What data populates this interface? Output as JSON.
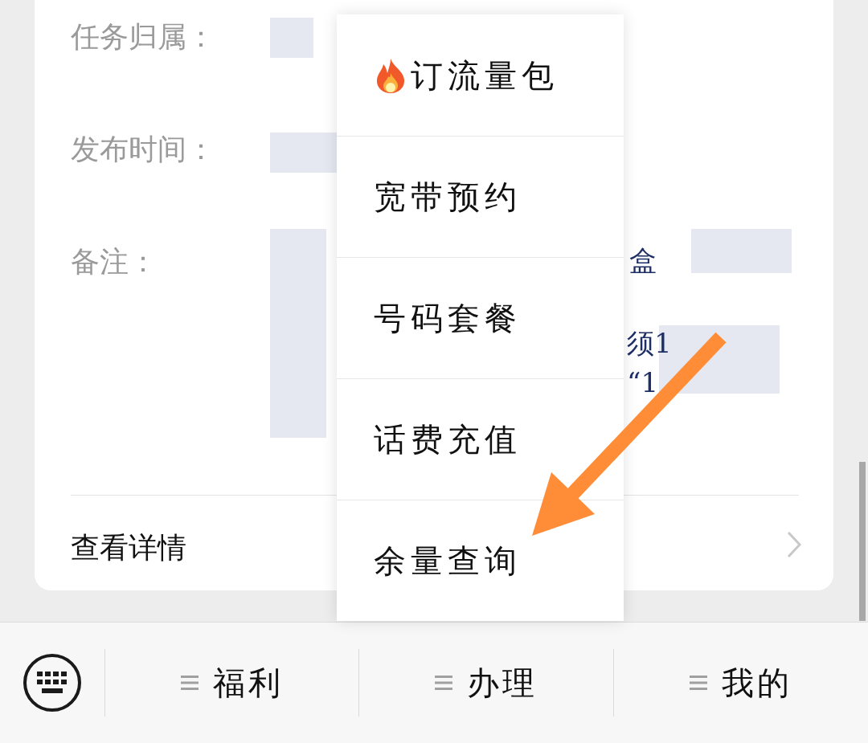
{
  "card": {
    "fields": [
      {
        "label": "任务归属："
      },
      {
        "label": "发布时间："
      },
      {
        "label": "备注："
      }
    ],
    "fragments": [
      "盒",
      "须1",
      "“1"
    ],
    "detail_link": "查看详情"
  },
  "popup_menu": {
    "items": [
      {
        "label": "订流量包",
        "kind": "hot"
      },
      {
        "label": "宽带预约",
        "kind": "plain"
      },
      {
        "label": "号码套餐",
        "kind": "plain"
      },
      {
        "label": "话费充值",
        "kind": "plain"
      },
      {
        "label": "余量查询",
        "kind": "plain"
      }
    ]
  },
  "bottom_menu": {
    "items": [
      {
        "label": "福利"
      },
      {
        "label": "办理"
      },
      {
        "label": "我的"
      }
    ]
  }
}
